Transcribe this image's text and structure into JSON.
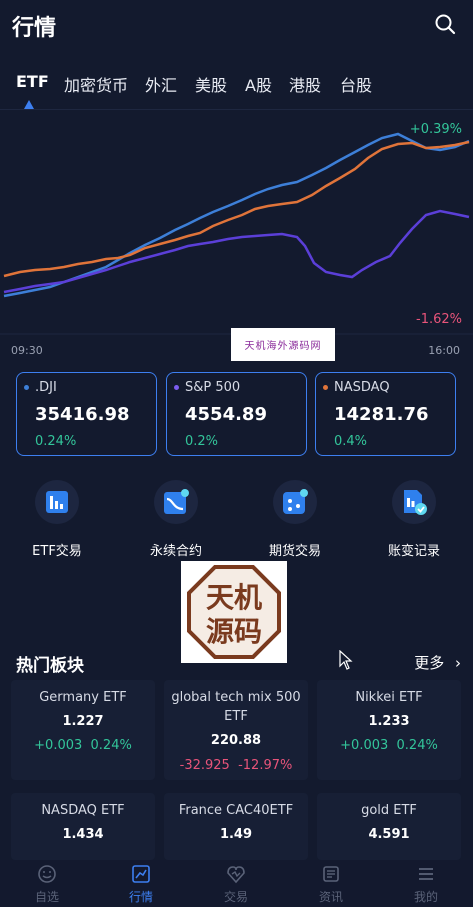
{
  "header": {
    "title": "行情",
    "search_icon": "search-icon"
  },
  "tabs": [
    {
      "label": "ETF",
      "active": true
    },
    {
      "label": "加密货币"
    },
    {
      "label": "外汇"
    },
    {
      "label": "美股"
    },
    {
      "label": "A股"
    },
    {
      "label": "港股"
    },
    {
      "label": "台股"
    }
  ],
  "chart": {
    "pct_high": "+0.39%",
    "pct_low": "-1.62%",
    "time_start": "09:30",
    "time_end": "16:00",
    "colors": {
      "dji": "#3d7fd8",
      "sp500": "#5b3fd8",
      "nasdaq": "#e0743a"
    }
  },
  "watermark_top": "天机海外源码网",
  "indices": [
    {
      "name": ".DJI",
      "value": "35416.98",
      "change": "0.24%",
      "dot_color": "#3d7fd8"
    },
    {
      "name": "S&P 500",
      "value": "4554.89",
      "change": "0.2%",
      "dot_color": "#7b5cf0"
    },
    {
      "name": "NASDAQ",
      "value": "14281.76",
      "change": "0.4%",
      "dot_color": "#e0743a"
    }
  ],
  "shortcuts": [
    {
      "label": "ETF交易",
      "icon": "bar-chart-icon"
    },
    {
      "label": "永续合约",
      "icon": "curve-chart-icon"
    },
    {
      "label": "期货交易",
      "icon": "dice-icon"
    },
    {
      "label": "账变记录",
      "icon": "document-check-icon"
    }
  ],
  "watermark_center": {
    "line1": "天机",
    "line2": "源码"
  },
  "hot": {
    "title": "热门板块",
    "more": "更多",
    "items": [
      {
        "name": "Germany ETF",
        "price": "1.227",
        "change": "+0.003",
        "pct": "0.24%",
        "dir": "up"
      },
      {
        "name": "global tech mix 500 ETF",
        "price": "220.88",
        "change": "-32.925",
        "pct": "-12.97%",
        "dir": "down"
      },
      {
        "name": "Nikkei ETF",
        "price": "1.233",
        "change": "+0.003",
        "pct": "0.24%",
        "dir": "up"
      },
      {
        "name": "NASDAQ ETF",
        "price": "1.434",
        "change": "",
        "pct": "",
        "dir": "up"
      },
      {
        "name": "France CAC40ETF",
        "price": "1.49",
        "change": "",
        "pct": "",
        "dir": "down"
      },
      {
        "name": "gold ETF",
        "price": "4.591",
        "change": "",
        "pct": "",
        "dir": "down"
      }
    ]
  },
  "nav": [
    {
      "label": "自选",
      "icon": "smiley-icon"
    },
    {
      "label": "行情",
      "icon": "chart-square-icon",
      "active": true
    },
    {
      "label": "交易",
      "icon": "exchange-icon"
    },
    {
      "label": "资讯",
      "icon": "news-icon"
    },
    {
      "label": "我的",
      "icon": "profile-icon"
    }
  ]
}
